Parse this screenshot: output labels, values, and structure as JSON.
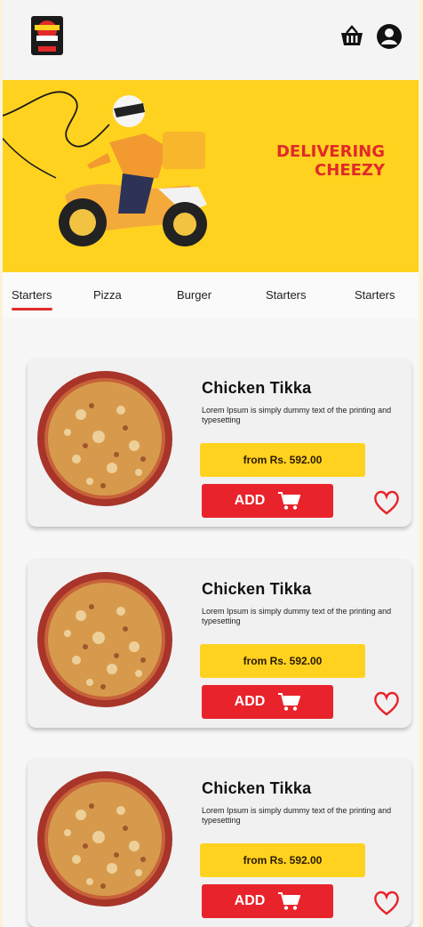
{
  "header": {
    "logo_icon": "brand-logo",
    "basket_icon": "basket-icon",
    "account_icon": "account-icon"
  },
  "banner": {
    "line1": "DELIVERING",
    "line2": "CHEEZY",
    "colors": {
      "background": "#ffd21f",
      "text": "#e12a2a"
    }
  },
  "tabs": [
    {
      "label": "Starters",
      "active": true
    },
    {
      "label": "Pizza",
      "active": false
    },
    {
      "label": "Burger",
      "active": false
    },
    {
      "label": "Starters",
      "active": false
    },
    {
      "label": "Starters",
      "active": false
    }
  ],
  "items": [
    {
      "title": "Chicken Tikka",
      "description": "Lorem Ipsum is simply dummy text of the printing and typesetting",
      "price": "from Rs. 592.00",
      "add_label": "ADD"
    },
    {
      "title": "Chicken Tikka",
      "description": "Lorem Ipsum is simply dummy text of the printing and typesetting",
      "price": "from Rs. 592.00",
      "add_label": "ADD"
    },
    {
      "title": "Chicken Tikka",
      "description": "Lorem Ipsum is simply dummy text of the printing and typesetting",
      "price": "from Rs. 592.00",
      "add_label": "ADD"
    }
  ],
  "colors": {
    "accent_red": "#e8232b",
    "accent_yellow": "#ffd21f"
  }
}
